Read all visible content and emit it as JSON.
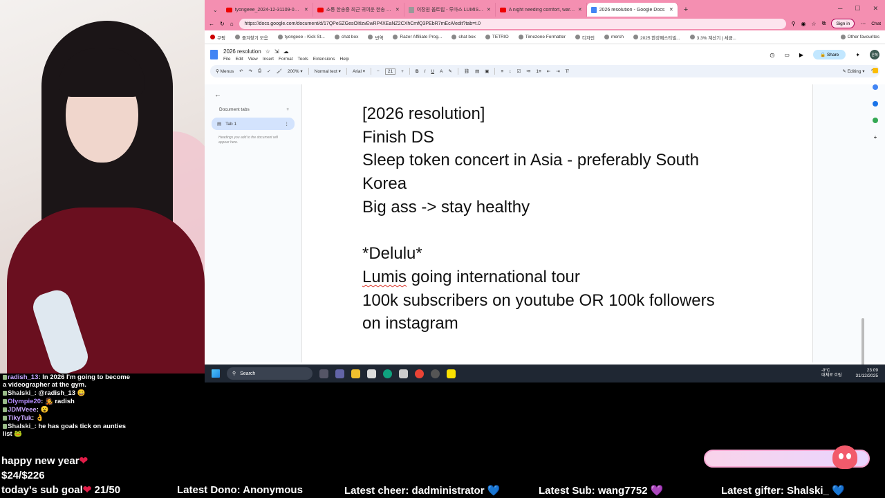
{
  "browser": {
    "tabs": [
      {
        "title": "tyongeee_2024-12-31109-00-082-",
        "icon": "youtube-icon"
      },
      {
        "title": "소통 한송중 최근 귀여운 한송 브라우",
        "icon": "youtube-icon"
      },
      {
        "title": "이장원 옵트립 - 루마스 LUMIS 2021",
        "icon": "page-icon"
      },
      {
        "title": "A night needing comfort, warm pi",
        "icon": "youtube-icon"
      },
      {
        "title": "2026 resolution - Google Docs",
        "icon": "docs-icon",
        "active": true
      }
    ],
    "url": "https://docs.google.com/document/d/17QPeSZGesOItIzvEwRP4XEaNZ2CXhCmfQ3PEbR7mEcA/edit?tab=t.0",
    "signin": "Sign in",
    "chat": "Chat",
    "bookmarks": [
      "쿠핑",
      "즐겨찾기 모음",
      "tyongeee - Kick St...",
      "chat box",
      "번역",
      "Razer Affiliate Prog...",
      "chat box",
      "TETRIO",
      "Timezone Formatter",
      "디자인",
      "merch",
      "2025 한강페스티벌...",
      "3.3% 계산기 | 세금..."
    ],
    "other_favourites": "Other favourites"
  },
  "docs": {
    "title": "2026 resolution",
    "menu": [
      "File",
      "Edit",
      "View",
      "Insert",
      "Format",
      "Tools",
      "Extensions",
      "Help"
    ],
    "share": "Share",
    "avatar": "은혜",
    "toolbar": {
      "menus": "Menus",
      "zoom": "200%",
      "style": "Normal text",
      "font": "Arial",
      "size": "21",
      "mode": "Editing"
    },
    "ruler": [
      "1",
      "2",
      "3",
      "4",
      "5",
      "6"
    ],
    "tabs_panel": {
      "title": "Document tabs",
      "tab": "Tab 1",
      "hint": "Headings you add to the document will appear here."
    },
    "lines": [
      "[2026 resolution]",
      "Finish DS",
      "Sleep token concert in Asia - preferably South",
      "Korea",
      "Big ass -> stay healthy",
      "",
      "*Delulu*",
      "going international tour",
      "100k subscribers on youtube OR 100k followers",
      "on instagram"
    ],
    "misspelled": "Lumis"
  },
  "taskbar": {
    "search": "Search",
    "weather_temp": "-9°C",
    "weather_desc": "대체로 흐림",
    "time": "23:09",
    "date": "31/12/2025"
  },
  "chat": [
    {
      "user": "radish_13",
      "text": "In 2026 I'm going to become a videographer at the gym."
    },
    {
      "user": "Shalski_",
      "text": "@radish_13 😀"
    },
    {
      "user": "Olympie20",
      "text": "🧑‍🎤 radish"
    },
    {
      "user": "JDMVeee",
      "text": "😮"
    },
    {
      "user": "TikyTuk",
      "text": "👌"
    },
    {
      "user": "Shalski_",
      "text": "he has goals tick on aunties list 🐸"
    }
  ],
  "overlay": {
    "greeting": "happy new year",
    "donation_goal": "$24/$226",
    "sub_goal_label": "today's sub goal",
    "sub_goal_value": "21/50",
    "latest_dono": "Latest Dono: Anonymous",
    "latest_cheer": "Latest cheer: dadministrator",
    "latest_sub": "Latest Sub: wang7752",
    "latest_gifter": "Latest gifter: Shalski_"
  }
}
